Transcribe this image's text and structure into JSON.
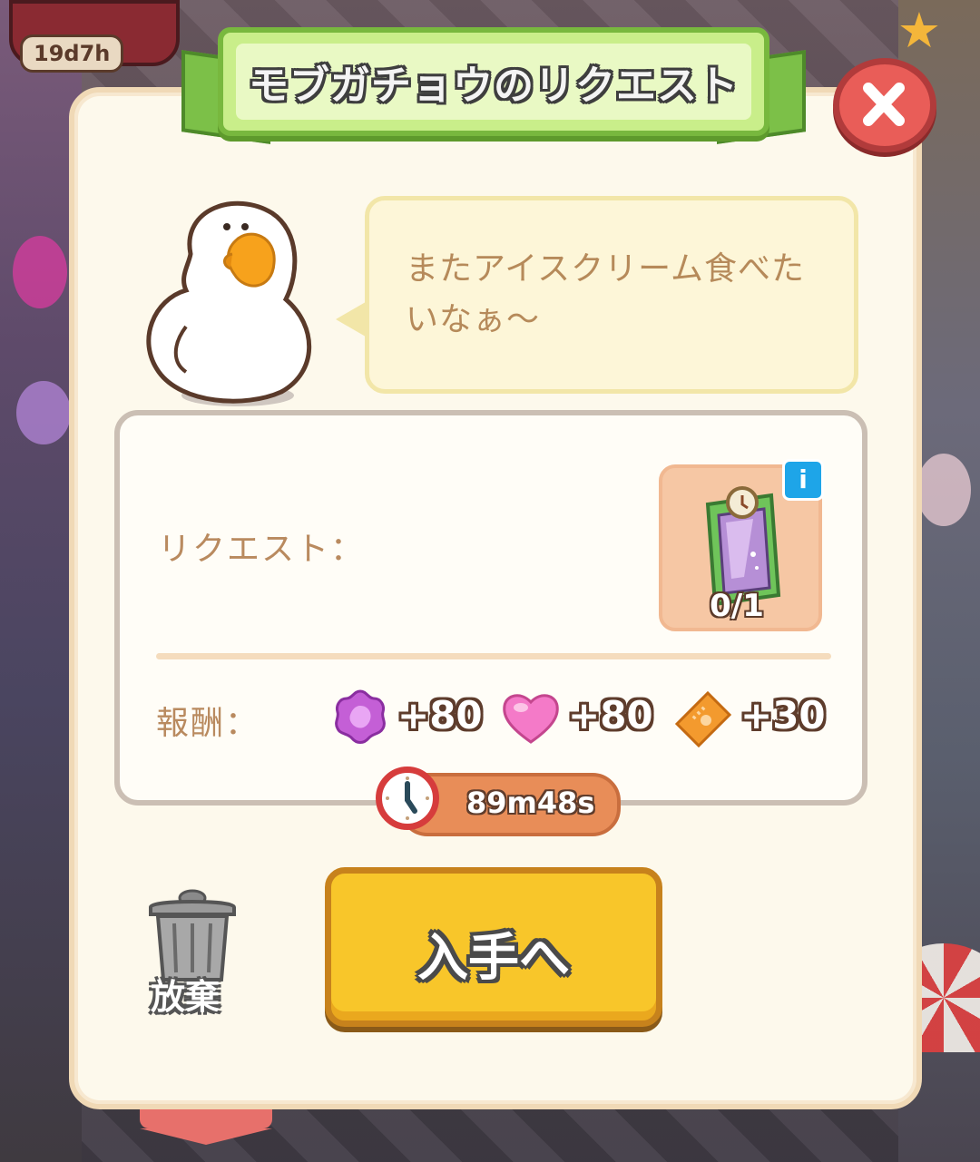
{
  "background": {
    "event_timer": "19d7h"
  },
  "dialog": {
    "title": "モブガチョウのリクエスト",
    "speech": "またアイスクリーム食べたいなぁ～",
    "request_label": "リクエスト：",
    "request_item": {
      "icon": "mirror-wardrobe-icon",
      "count": "0/1"
    },
    "reward_label": "報酬：",
    "rewards": [
      {
        "icon": "purple-flower-gem-icon",
        "amount": "+80",
        "color": "#c45fd6"
      },
      {
        "icon": "pink-heart-icon",
        "amount": "+80",
        "color": "#f47ac8"
      },
      {
        "icon": "orange-ticket-icon",
        "amount": "+30",
        "color": "#f39a2e"
      }
    ],
    "timer": "89m48s",
    "discard_label": "放棄",
    "obtain_label": "入手へ"
  },
  "colors": {
    "ribbon": "#c9ee8a",
    "close": "#e95d58",
    "obtain_button": "#f8c62a",
    "timer": "#e88d58"
  }
}
